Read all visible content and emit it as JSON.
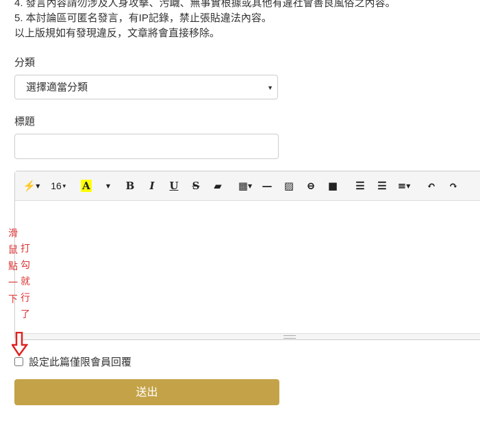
{
  "rules": [
    "4. 發言內容請勿涉及人身攻擊、污衊、無事實根據或其他有違社會善良風俗之內容。",
    "5. 本討論區可匿名發言，有IP記錄，禁止張貼違法內容。",
    "以上版規如有發現違反，文章將會直接移除。"
  ],
  "category": {
    "label": "分類",
    "selected": "選擇適當分類"
  },
  "title": {
    "label": "標題",
    "value": ""
  },
  "toolbar": {
    "font_size": "16",
    "color_letter": "A",
    "bold": "B",
    "italic": "I",
    "underline": "U",
    "strike": "S"
  },
  "annotation": {
    "col1": "滑鼠點一下",
    "col2": "打勾就行了"
  },
  "members_only": {
    "label": "設定此篇僅限會員回覆",
    "checked": false
  },
  "submit_label": "送出"
}
